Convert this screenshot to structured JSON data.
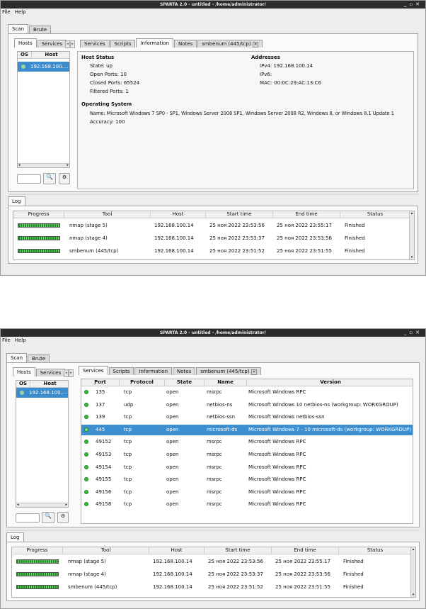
{
  "window_title": "SPARTA 2.0 - untitled - /home/administrator/",
  "window_controls": {
    "minimize": "_",
    "maximize": "▫",
    "close": "✕"
  },
  "menu": {
    "file": "File",
    "help": "Help"
  },
  "main_tabs": {
    "scan": "Scan",
    "brute": "Brute"
  },
  "left_tabs": {
    "hosts": "Hosts",
    "services": "Services"
  },
  "host_table": {
    "col_os": "OS",
    "col_host": "Host",
    "host_value": "192.168.100....",
    "host_value_2": "192.168.100...."
  },
  "detail_tabs": {
    "services": "Services",
    "scripts": "Scripts",
    "information": "Information",
    "notes": "Notes",
    "smbenum": "smbenum (445/tcp)"
  },
  "info": {
    "host_status": "Host Status",
    "state": "State:  up",
    "open_ports": "Open Ports:  10",
    "closed_ports": "Closed Ports:  65524",
    "filtered_ports": "Filtered Ports:  1",
    "addresses": "Addresses",
    "ipv4": "IPv4:  192.168.100.14",
    "ipv6": "IPv6:",
    "mac": "MAC:  00:0C:29:AC:13:C6",
    "os_title": "Operating System",
    "os_name": "Name:  Microsoft Windows 7 SP0 - SP1, Windows Server 2008 SP1, Windows Server 2008 R2, Windows 8, or Windows 8.1 Update 1",
    "accuracy": "Accuracy:  100"
  },
  "services_table": {
    "headers": [
      "Port",
      "Protocol",
      "State",
      "Name",
      "Version"
    ],
    "rows": [
      {
        "port": "135",
        "protocol": "tcp",
        "state": "open",
        "name": "msrpc",
        "version": "Microsoft Windows RPC"
      },
      {
        "port": "137",
        "protocol": "udp",
        "state": "open",
        "name": "netbios-ns",
        "version": "Microsoft Windows 10 netbios-ns (workgroup: WORKGROUP)"
      },
      {
        "port": "139",
        "protocol": "tcp",
        "state": "open",
        "name": "netbios-ssn",
        "version": "Microsoft Windows netbios-ssn"
      },
      {
        "port": "445",
        "protocol": "tcp",
        "state": "open",
        "name": "microsoft-ds",
        "version": "Microsoft Windows 7 - 10 microsoft-ds (workgroup: WORKGROUP)"
      },
      {
        "port": "49152",
        "protocol": "tcp",
        "state": "open",
        "name": "msrpc",
        "version": "Microsoft Windows RPC"
      },
      {
        "port": "49153",
        "protocol": "tcp",
        "state": "open",
        "name": "msrpc",
        "version": "Microsoft Windows RPC"
      },
      {
        "port": "49154",
        "protocol": "tcp",
        "state": "open",
        "name": "msrpc",
        "version": "Microsoft Windows RPC"
      },
      {
        "port": "49155",
        "protocol": "tcp",
        "state": "open",
        "name": "msrpc",
        "version": "Microsoft Windows RPC"
      },
      {
        "port": "49156",
        "protocol": "tcp",
        "state": "open",
        "name": "msrpc",
        "version": "Microsoft Windows RPC"
      },
      {
        "port": "49158",
        "protocol": "tcp",
        "state": "open",
        "name": "msrpc",
        "version": "Microsoft Windows RPC"
      }
    ],
    "selected_row": 3
  },
  "log": {
    "tab": "Log",
    "headers": [
      "Progress",
      "Tool",
      "Host",
      "Start time",
      "End time",
      "Status"
    ],
    "rows": [
      {
        "tool": "nmap (stage 5)",
        "host": "192.168.100.14",
        "start": "25 ноя 2022 23:53:56",
        "end": "25 ноя 2022 23:55:17",
        "status": "Finished"
      },
      {
        "tool": "nmap (stage 4)",
        "host": "192.168.100.14",
        "start": "25 ноя 2022 23:53:37",
        "end": "25 ноя 2022 23:53:56",
        "status": "Finished"
      },
      {
        "tool": "smbenum (445/tcp)",
        "host": "192.168.100.14",
        "start": "25 ноя 2022 23:51:52",
        "end": "25 ноя 2022 23:51:55",
        "status": "Finished"
      }
    ]
  },
  "colors": {
    "accent": "#3d8fd0",
    "titlebar": "#2b2b2b",
    "open_port": "#33c13a"
  }
}
